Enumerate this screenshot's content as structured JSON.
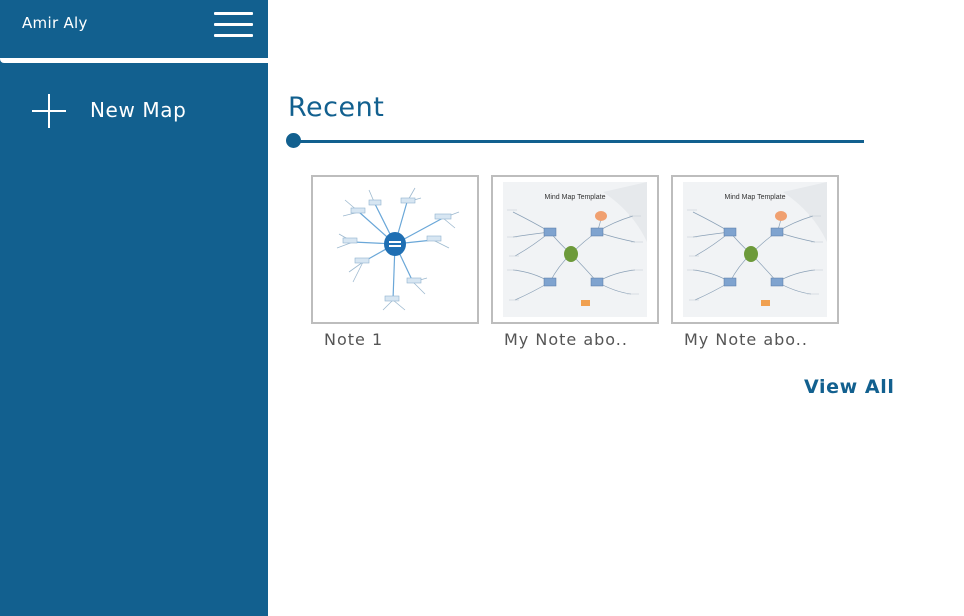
{
  "sidebar": {
    "user_name": "Amir Aly",
    "menu_icon": "hamburger-menu-icon",
    "new_map_icon": "plus-icon",
    "new_map_label": "New Map"
  },
  "main": {
    "section_title": "Recent",
    "recent_items": [
      {
        "label": "Note 1",
        "thumbnail": "radial-mind-map"
      },
      {
        "label": "My Note abo..",
        "thumbnail": "mind-map-template",
        "thumbnail_title": "Mind Map Template"
      },
      {
        "label": "My Note abo..",
        "thumbnail": "mind-map-template",
        "thumbnail_title": "Mind Map Template"
      }
    ],
    "view_all_label": "View All"
  },
  "colors": {
    "brand": "#12608f",
    "sidebar_bg": "#12608f",
    "card_border": "#bdbdbd",
    "label_text": "#555555"
  }
}
